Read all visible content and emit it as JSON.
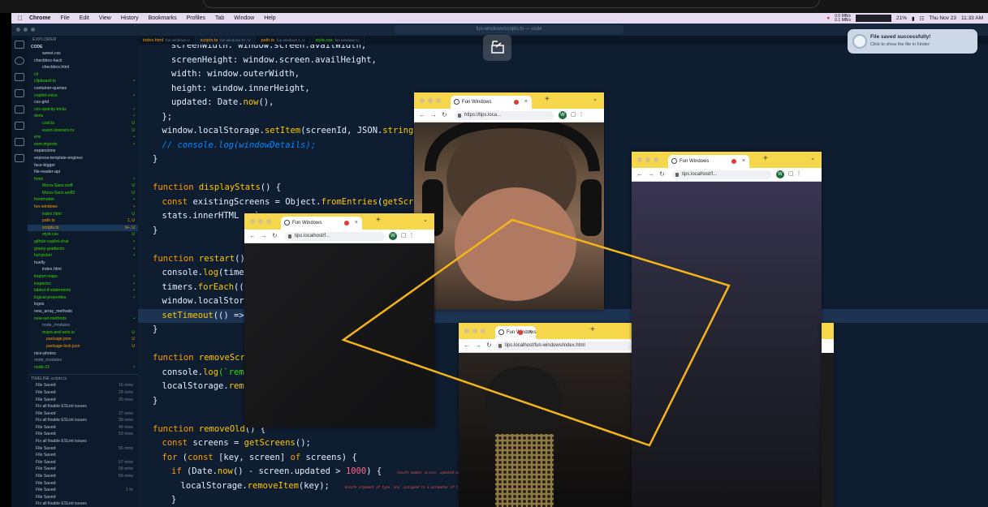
{
  "menubar": {
    "app": "Chrome",
    "items": [
      "File",
      "Edit",
      "View",
      "History",
      "Bookmarks",
      "Profiles",
      "Tab",
      "Window",
      "Help"
    ],
    "battery": "21%",
    "net_up": "0.0 MB/s",
    "net_down": "0.1 MB/s",
    "date": "Thu Nov 23",
    "time": "11:33 AM"
  },
  "editor": {
    "title": "fun-windows/scripts.ts — code",
    "tabs": [
      {
        "name": "index.html",
        "path": "fun-windows U"
      },
      {
        "name": "scripts.ts",
        "path": "fun-windows 9+, U"
      },
      {
        "name": "path.ts",
        "path": "fun-windows 1, U"
      },
      {
        "name": "style.css",
        "path": "fun-windows U"
      }
    ],
    "explorer_label": "EXPLORER",
    "workspace_label": "CODE",
    "tree": [
      {
        "name": "sweet.css",
        "indent": 2,
        "color": "#c7d2de",
        "badge": ""
      },
      {
        "name": "checkbox-hack",
        "indent": 0,
        "color": "#c7d2de",
        "badge": ""
      },
      {
        "name": "checkbox.html",
        "indent": 2,
        "color": "#c7d2de",
        "badge": ""
      },
      {
        "name": "cli",
        "indent": 0,
        "color": "#3ad900",
        "badge": ""
      },
      {
        "name": "clipboard-ts",
        "indent": 0,
        "color": "#3ad900",
        "badge": "•"
      },
      {
        "name": "container-queries",
        "indent": 0,
        "color": "#c7d2de",
        "badge": ""
      },
      {
        "name": "copilot-voice",
        "indent": 0,
        "color": "#3ad900",
        "badge": "•"
      },
      {
        "name": "css-grid",
        "indent": 0,
        "color": "#c7d2de",
        "badge": ""
      },
      {
        "name": "css-opacity-tricks",
        "indent": 0,
        "color": "#3ad900",
        "badge": "•"
      },
      {
        "name": "dens",
        "indent": 0,
        "color": "#3ad900",
        "badge": "•"
      },
      {
        "name": "cool.ts",
        "indent": 2,
        "color": "#3ad900",
        "badge": "U"
      },
      {
        "name": "event-listeners.ts",
        "indent": 2,
        "color": "#3ad900",
        "badge": "U"
      },
      {
        "name": "env",
        "indent": 0,
        "color": "#3ad900",
        "badge": "•"
      },
      {
        "name": "esm-imports",
        "indent": 0,
        "color": "#3ad900",
        "badge": "•"
      },
      {
        "name": "expansions",
        "indent": 0,
        "color": "#c7d2de",
        "badge": ""
      },
      {
        "name": "express-template-engines",
        "indent": 0,
        "color": "#c7d2de",
        "badge": ""
      },
      {
        "name": "face-bigger",
        "indent": 0,
        "color": "#c7d2de",
        "badge": ""
      },
      {
        "name": "file-reader-api",
        "indent": 0,
        "color": "#c7d2de",
        "badge": ""
      },
      {
        "name": "fonts",
        "indent": 0,
        "color": "#3ad900",
        "badge": "•"
      },
      {
        "name": "Mona-Sans.woff",
        "indent": 2,
        "color": "#3ad900",
        "badge": "U"
      },
      {
        "name": "Mona-Sans.woff2",
        "indent": 2,
        "color": "#3ad900",
        "badge": "U"
      },
      {
        "name": "frontmatter",
        "indent": 0,
        "color": "#3ad900",
        "badge": "•"
      },
      {
        "name": "fun-windows",
        "indent": 0,
        "color": "#ff9d00",
        "badge": "•"
      },
      {
        "name": "index.html",
        "indent": 2,
        "color": "#3ad900",
        "badge": "U"
      },
      {
        "name": "path.ts",
        "indent": 2,
        "color": "#ff9d00",
        "badge": "1, U"
      },
      {
        "name": "scripts.ts",
        "indent": 2,
        "color": "#ff9d00",
        "badge": "9+, U"
      },
      {
        "name": "style.css",
        "indent": 2,
        "color": "#3ad900",
        "badge": "U"
      },
      {
        "name": "github-copilot-chat",
        "indent": 0,
        "color": "#3ad900",
        "badge": "•"
      },
      {
        "name": "grainy-gradients",
        "indent": 0,
        "color": "#3ad900",
        "badge": "•"
      },
      {
        "name": "hsl-picker",
        "indent": 0,
        "color": "#3ad900",
        "badge": "•"
      },
      {
        "name": "huelly",
        "indent": 0,
        "color": "#c7d2de",
        "badge": ""
      },
      {
        "name": "index.html",
        "indent": 2,
        "color": "#c7d2de",
        "badge": ""
      },
      {
        "name": "import-maps",
        "indent": 0,
        "color": "#3ad900",
        "badge": "•"
      },
      {
        "name": "inspector",
        "indent": 0,
        "color": "#3ad900",
        "badge": "•"
      },
      {
        "name": "labled-if-statements",
        "indent": 0,
        "color": "#3ad900",
        "badge": "•"
      },
      {
        "name": "logical-properties",
        "indent": 0,
        "color": "#3ad900",
        "badge": "•"
      },
      {
        "name": "logos",
        "indent": 0,
        "color": "#c7d2de",
        "badge": ""
      },
      {
        "name": "new_array_methods",
        "indent": 0,
        "color": "#c7d2de",
        "badge": ""
      },
      {
        "name": "new-set-methods",
        "indent": 0,
        "color": "#3ad900",
        "badge": "•"
      },
      {
        "name": "node_modules",
        "indent": 2,
        "color": "#8a96a4",
        "badge": ""
      },
      {
        "name": "maps-and-sets.ts",
        "indent": 2,
        "color": "#3ad900",
        "badge": "U"
      },
      {
        "name": "package.json",
        "indent": 3,
        "color": "#ff9d00",
        "badge": "U"
      },
      {
        "name": "package-lock.json",
        "indent": 3,
        "color": "#ff9d00",
        "badge": "U"
      },
      {
        "name": "nice-photos",
        "indent": 0,
        "color": "#c7d2de",
        "badge": ""
      },
      {
        "name": "node_modules",
        "indent": 0,
        "color": "#8a96a4",
        "badge": ""
      },
      {
        "name": "node-21",
        "indent": 0,
        "color": "#3ad900",
        "badge": "•"
      }
    ],
    "selected_tree_index": 25,
    "timeline_label": "TIMELINE scripts.ts",
    "timeline": [
      {
        "label": "File Saved",
        "time": "16 mins"
      },
      {
        "label": "File Saved",
        "time": "29 mins"
      },
      {
        "label": "File Saved",
        "time": "35 mins"
      },
      {
        "label": "Fix all fixable ESLint issues",
        "time": ""
      },
      {
        "label": "File Saved",
        "time": "37 mins"
      },
      {
        "label": "Fix all fixable ESLint issues",
        "time": "38 mins"
      },
      {
        "label": "File Saved",
        "time": "46 mins"
      },
      {
        "label": "File Saved",
        "time": "53 mins"
      },
      {
        "label": "Fix all fixable ESLint issues",
        "time": ""
      },
      {
        "label": "File Saved",
        "time": "56 mins"
      },
      {
        "label": "File Saved",
        "time": ""
      },
      {
        "label": "File Saved",
        "time": "57 mins"
      },
      {
        "label": "File Saved",
        "time": "58 mins"
      },
      {
        "label": "File Saved",
        "time": "59 mins"
      },
      {
        "label": "File Saved",
        "time": ""
      },
      {
        "label": "File Saved",
        "time": "1 hr"
      },
      {
        "label": "File Saved",
        "time": ""
      },
      {
        "label": "Fix all fixable ESLint issues",
        "time": ""
      }
    ],
    "code_lines": [
      {
        "indent": 2,
        "tokens": [
          [
            "pl",
            "screenWidth: window.screen.availWidth,"
          ]
        ]
      },
      {
        "indent": 2,
        "tokens": [
          [
            "pl",
            "screenHeight: window.screen.availHeight,"
          ]
        ]
      },
      {
        "indent": 2,
        "tokens": [
          [
            "pl",
            "width: window.outerWidth,"
          ]
        ]
      },
      {
        "indent": 2,
        "tokens": [
          [
            "pl",
            "height: window.innerHeight,"
          ]
        ]
      },
      {
        "indent": 2,
        "tokens": [
          [
            "pl",
            "updated: Date."
          ],
          [
            "fn",
            "now"
          ],
          [
            "pl",
            "(),"
          ]
        ]
      },
      {
        "indent": 1,
        "tokens": [
          [
            "pl",
            "};"
          ]
        ]
      },
      {
        "indent": 1,
        "tokens": [
          [
            "pl",
            "window.localStorage."
          ],
          [
            "fn",
            "setItem"
          ],
          [
            "pl",
            "(screenId, JSON."
          ],
          [
            "fn",
            "stringify"
          ],
          [
            "pl",
            "(win"
          ]
        ]
      },
      {
        "indent": 1,
        "tokens": [
          [
            "cm",
            "// console.log(windowDetails);"
          ]
        ]
      },
      {
        "indent": 0,
        "tokens": [
          [
            "pl",
            "}"
          ]
        ]
      },
      {
        "indent": 0,
        "tokens": []
      },
      {
        "indent": 0,
        "tokens": [
          [
            "kw",
            "function "
          ],
          [
            "fn",
            "displayStats"
          ],
          [
            "pl",
            "() {"
          ]
        ]
      },
      {
        "indent": 1,
        "tokens": [
          [
            "kw",
            "const "
          ],
          [
            "pl",
            "existingScreens = Object."
          ],
          [
            "fn",
            "fromEntries"
          ],
          [
            "pl",
            "("
          ],
          [
            "fn",
            "getScreens"
          ],
          [
            "pl",
            "())"
          ]
        ]
      },
      {
        "indent": 1,
        "tokens": [
          [
            "pl",
            "stats.innerHTML = `"
          ]
        ]
      },
      {
        "indent": 0,
        "tokens": [
          [
            "pl",
            "}"
          ]
        ]
      },
      {
        "indent": 0,
        "tokens": []
      },
      {
        "indent": 0,
        "tokens": [
          [
            "kw",
            "function "
          ],
          [
            "fn",
            "restart"
          ],
          [
            "pl",
            "() {"
          ]
        ]
      },
      {
        "indent": 1,
        "tokens": [
          [
            "pl",
            "console."
          ],
          [
            "fn",
            "log"
          ],
          [
            "pl",
            "(timers)"
          ]
        ]
      },
      {
        "indent": 1,
        "tokens": [
          [
            "pl",
            "timers."
          ],
          [
            "fn",
            "forEach"
          ],
          [
            "pl",
            "((tim"
          ]
        ]
      },
      {
        "indent": 1,
        "tokens": [
          [
            "pl",
            "window.localStorage"
          ]
        ]
      },
      {
        "indent": 1,
        "tokens": [
          [
            "fn",
            "setTimeout"
          ],
          [
            "pl",
            "(() => wi"
          ],
          [
            "pl",
            "                             "
          ],
          [
            "num",
            "000"
          ],
          [
            "pl",
            ");"
          ]
        ]
      },
      {
        "indent": 0,
        "tokens": [
          [
            "pl",
            "}"
          ]
        ]
      },
      {
        "indent": 0,
        "tokens": []
      },
      {
        "indent": 0,
        "tokens": [
          [
            "kw",
            "function "
          ],
          [
            "fn",
            "removeScreen"
          ]
        ]
      },
      {
        "indent": 1,
        "tokens": [
          [
            "pl",
            "console."
          ],
          [
            "fn",
            "log"
          ],
          [
            "str",
            "(`removi"
          ]
        ]
      },
      {
        "indent": 1,
        "tokens": [
          [
            "pl",
            "localStorage."
          ],
          [
            "fn",
            "remove"
          ]
        ]
      },
      {
        "indent": 0,
        "tokens": [
          [
            "pl",
            "}"
          ]
        ]
      },
      {
        "indent": 0,
        "tokens": []
      },
      {
        "indent": 0,
        "tokens": [
          [
            "kw",
            "function "
          ],
          [
            "fn",
            "removeOld"
          ],
          [
            "pl",
            "() {"
          ]
        ]
      },
      {
        "indent": 1,
        "tokens": [
          [
            "kw",
            "const "
          ],
          [
            "pl",
            "screens = "
          ],
          [
            "fn",
            "getScreens"
          ],
          [
            "pl",
            "();"
          ]
        ]
      },
      {
        "indent": 1,
        "tokens": [
          [
            "kw",
            "for "
          ],
          [
            "pl",
            "("
          ],
          [
            "kw",
            "const "
          ],
          [
            "pl",
            "[key, screen] "
          ],
          [
            "kw",
            "of "
          ],
          [
            "pl",
            "screens) {"
          ]
        ]
      },
      {
        "indent": 2,
        "tokens": [
          [
            "kw",
            "if "
          ],
          [
            "pl",
            "(Date."
          ],
          [
            "fn",
            "now"
          ],
          [
            "pl",
            "() - screen.updated > "
          ],
          [
            "num",
            "1000"
          ],
          [
            "pl",
            ") {   "
          ],
          [
            "err",
            "Unsafe member access .updated on an `any`"
          ]
        ]
      },
      {
        "indent": 3,
        "tokens": [
          [
            "pl",
            "localStorage."
          ],
          [
            "fn",
            "removeItem"
          ],
          [
            "pl",
            "(key);   "
          ],
          [
            "err",
            "Unsafe argument of type `any` assigned to a parameter of type"
          ]
        ]
      },
      {
        "indent": 2,
        "tokens": [
          [
            "pl",
            "}"
          ]
        ]
      }
    ],
    "highlight_line": 19
  },
  "browser_windows": [
    {
      "id": "w1",
      "title": "Fun Windows",
      "url": "https://tips.loca...",
      "avatar": "W"
    },
    {
      "id": "w2",
      "title": "Fun Windows",
      "url": "tips.localhost/f...",
      "avatar": "W"
    },
    {
      "id": "w3",
      "title": "Fun Windows",
      "url": "tips.localhost/f...",
      "avatar": "W"
    },
    {
      "id": "w4",
      "title": "Fun Windows",
      "url": "tips.localhost/fun-windows/index.html",
      "avatar": ""
    }
  ],
  "notification": {
    "title": "File saved successfully!",
    "subtitle": "Click to show the file in Finder"
  },
  "colors": {
    "polygon": "#f4b41a",
    "window_chrome": "#f6d64a",
    "editor_bg": "#0e1d30"
  }
}
